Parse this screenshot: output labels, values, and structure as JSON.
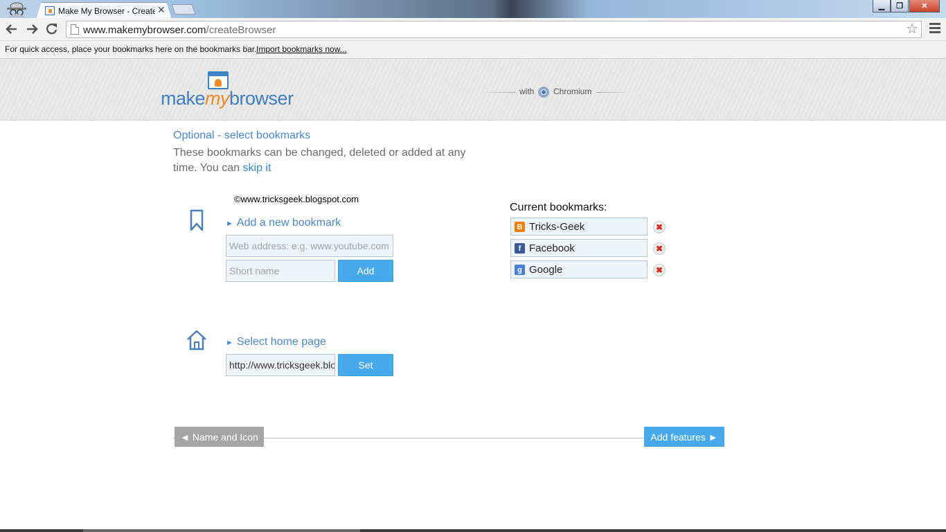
{
  "browser": {
    "tab_title": "Make My Browser - Create",
    "tab_close": "✕",
    "url_domain": "www.makemybrowser.com",
    "url_path": "/createBrowser",
    "bookmarks_bar_hint": "For quick access, place your bookmarks here on the bookmarks bar.",
    "bookmarks_bar_import": "Import bookmarks now..."
  },
  "header": {
    "logo_part1": "make",
    "logo_part2": "my",
    "logo_part3": "browser",
    "with_label": "with",
    "engine": "Chromium"
  },
  "step": {
    "title": "Optional - select bookmarks",
    "description": "These bookmarks can be changed, deleted or added at any time. You can ",
    "skip_link": "skip it"
  },
  "watermark": "©www.tricksgeek.blogspot.com",
  "add_bookmark": {
    "heading": "Add a new bookmark",
    "address_placeholder": "Web address: e.g. www.youtube.com",
    "name_placeholder": "Short name",
    "button": "Add"
  },
  "home_page": {
    "heading": "Select home page",
    "value": "http://www.tricksgeek.blogspot.com",
    "button": "Set"
  },
  "current_bookmarks": {
    "title": "Current bookmarks:",
    "items": [
      {
        "name": "Tricks-Geek",
        "icon": "blogger-icon",
        "color": "#f57d00",
        "glyph": "B"
      },
      {
        "name": "Facebook",
        "icon": "facebook-icon",
        "color": "#3b5998",
        "glyph": "f"
      },
      {
        "name": "Google",
        "icon": "google-icon",
        "color": "#4a7fd6",
        "glyph": "g"
      }
    ],
    "remove_glyph": "✖"
  },
  "navigation": {
    "back": "◄ Name and Icon",
    "next": "Add features ►"
  },
  "colors": {
    "accent": "#48a9ea",
    "link": "#4a88c9",
    "logo_blue": "#3f7ec0",
    "logo_orange": "#f08a24"
  }
}
